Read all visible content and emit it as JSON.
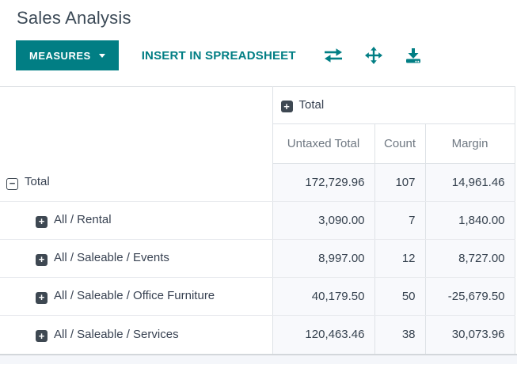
{
  "page": {
    "title": "Sales Analysis"
  },
  "toolbar": {
    "measures_label": "MEASURES",
    "insert_label": "INSERT IN SPREADSHEET",
    "accent_color": "#017e84",
    "icons": [
      "flip-axis-icon",
      "expand-all-icon",
      "download-icon"
    ]
  },
  "pivot": {
    "column_group": {
      "label": "Total",
      "state": "collapsed"
    },
    "measures": [
      "Untaxed Total",
      "Count",
      "Margin"
    ],
    "rows": [
      {
        "label": "Total",
        "state": "expanded",
        "values": [
          "172,729.96",
          "107",
          "14,961.46"
        ]
      },
      {
        "label": "All / Rental",
        "state": "collapsed",
        "values": [
          "3,090.00",
          "7",
          "1,840.00"
        ]
      },
      {
        "label": "All / Saleable / Events",
        "state": "collapsed",
        "values": [
          "8,997.00",
          "12",
          "8,727.00"
        ]
      },
      {
        "label": "All / Saleable / Office Furniture",
        "state": "collapsed",
        "values": [
          "40,179.50",
          "50",
          "-25,679.50"
        ]
      },
      {
        "label": "All / Saleable / Services",
        "state": "collapsed",
        "values": [
          "120,463.46",
          "38",
          "30,073.96"
        ]
      }
    ]
  }
}
